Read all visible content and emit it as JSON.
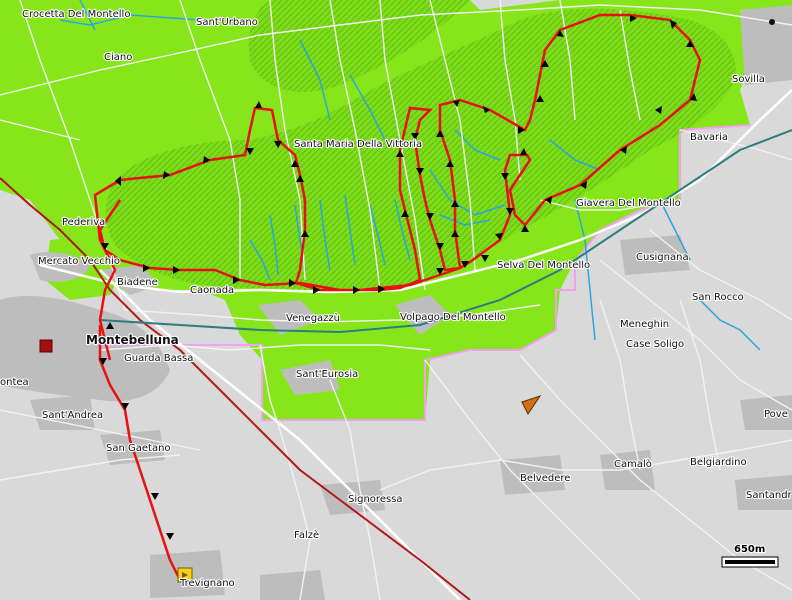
{
  "map": {
    "colors": {
      "land": "#d9d9d9",
      "forest": "#86e61a",
      "hill": "#62c418",
      "route": "#e81010",
      "road": "#ffffff",
      "water": "#2aa6e0",
      "railway": "#b01818",
      "boundary": "#f3a0f3",
      "urban": "#bdbdbd",
      "arrow": "#000000"
    },
    "places": {
      "crocetta": "Crocetta Del Montello",
      "sant_urbano": "Sant'Urbano",
      "ciano": "Ciano",
      "santa_maria": "Santa Maria Della Vittoria",
      "sovilla": "Sovilla",
      "bavaria": "Bavaria",
      "giavera": "Giavera Del Montello",
      "pederiva": "Pederiva",
      "mercato_vecchio": "Mercato Vecchio",
      "biadene": "Biadene",
      "caonada": "Caonada",
      "selva": "Selva Del Montello",
      "cusignana": "Cusignana",
      "san_rocco": "San Rocco",
      "venegazzu": "Venegazzù",
      "volpago": "Volpago Del Montello",
      "meneghin": "Meneghin",
      "case_soligo": "Case Soligo",
      "montebelluna": "Montebelluna",
      "guarda_bassa": "Guarda Bassa",
      "montea": "ontea",
      "sant_eurosia": "Sant'Eurosia",
      "sant_andrea": "Sant'Andrea",
      "san_gaetano": "San Gaetano",
      "camalo": "Camalò",
      "belgiardino": "Belgiardino",
      "belvedere": "Belvedere",
      "povegliano": "Pove",
      "santandra": "Santandr",
      "signoressa": "Signoressa",
      "falze": "Falzè",
      "trevignano": "Trevignano"
    },
    "scale_bar": {
      "label": "650m"
    }
  }
}
